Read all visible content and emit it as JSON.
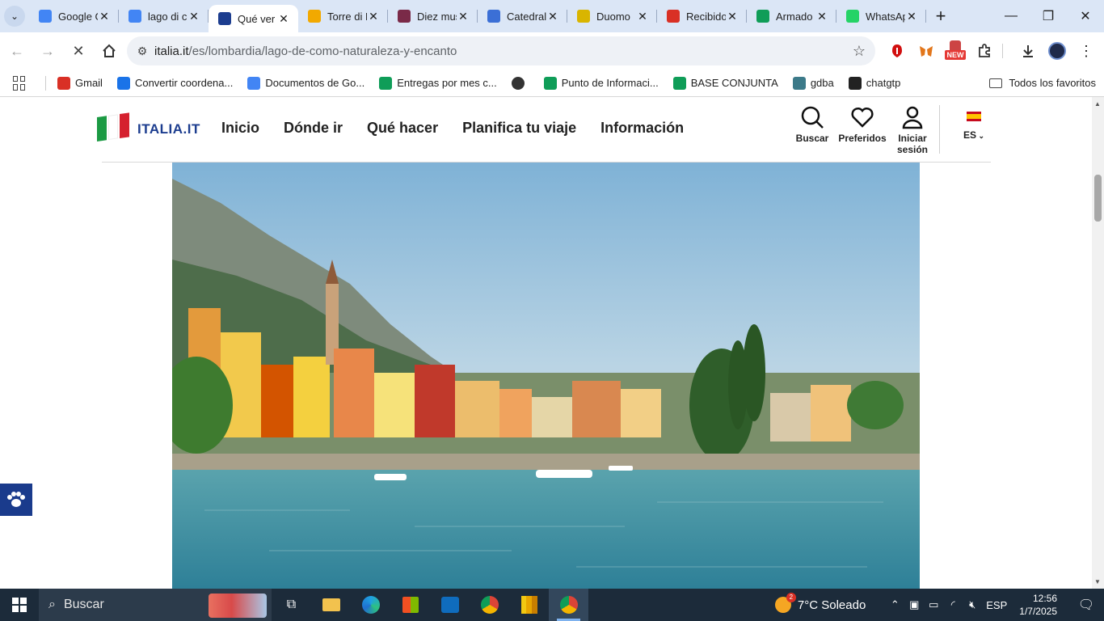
{
  "browser": {
    "tabs": [
      {
        "title": "Google Gemini",
        "icon": "gemini-sparkle-icon",
        "color": "#4285f4",
        "active": false
      },
      {
        "title": "lago di como",
        "icon": "google-g-icon",
        "color": "#4285f4",
        "active": false
      },
      {
        "title": "Qué ver en el lago",
        "icon": "italia-site-icon",
        "color": "#1c3d8f",
        "active": true
      },
      {
        "title": "Torre di Milano",
        "icon": "ef-icon",
        "color": "#f2a900",
        "active": false
      },
      {
        "title": "Diez museos",
        "icon": "document-icon",
        "color": "#7a2a48",
        "active": false
      },
      {
        "title": "Catedral",
        "icon": "chart-icon",
        "color": "#3b6fd6",
        "active": false
      },
      {
        "title": "Duomo",
        "icon": "landscape-icon",
        "color": "#d9b500",
        "active": false
      },
      {
        "title": "Recibidos",
        "icon": "gmail-icon",
        "color": "#d93025",
        "active": false
      },
      {
        "title": "Armado",
        "icon": "sheets-icon",
        "color": "#0f9d58",
        "active": false
      },
      {
        "title": "WhatsApp",
        "icon": "whatsapp-icon",
        "color": "#25d366",
        "active": false
      }
    ],
    "url_host": "italia.it",
    "url_path": "/es/lombardia/lago-de-como-naturaleza-y-encanto",
    "ext_badge": "NEW",
    "bookmarks": [
      {
        "label": "Gmail",
        "icon": "gmail-icon",
        "color": "#d93025"
      },
      {
        "label": "Convertir coordena...",
        "icon": "gps-icon",
        "color": "#1a73e8"
      },
      {
        "label": "Documentos de Go...",
        "icon": "docs-icon",
        "color": "#4285f4"
      },
      {
        "label": "Entregas por mes c...",
        "icon": "sheets-icon",
        "color": "#0f9d58"
      },
      {
        "label": "",
        "icon": "globe-icon",
        "color": "#333333"
      },
      {
        "label": "Punto de Informaci...",
        "icon": "sheets-icon",
        "color": "#0f9d58"
      },
      {
        "label": "BASE CONJUNTA",
        "icon": "sheets-icon",
        "color": "#0f9d58"
      },
      {
        "label": "gdba",
        "icon": "gdba-icon",
        "color": "#3c7a89"
      },
      {
        "label": "chatgtp",
        "icon": "openai-icon",
        "color": "#222222"
      }
    ],
    "all_favorites": "Todos los favoritos"
  },
  "site": {
    "logo_text": "ITALIA.IT",
    "nav": [
      "Inicio",
      "Dónde ir",
      "Qué hacer",
      "Planifica tu viaje",
      "Información"
    ],
    "search_label": "Buscar",
    "favorites_label": "Preferidos",
    "login_label_1": "Iniciar",
    "login_label_2": "sesión",
    "lang": "ES"
  },
  "taskbar": {
    "search_placeholder": "Buscar",
    "weather": "7°C Soleado",
    "weather_badge": "2",
    "lang": "ESP",
    "time": "12:56",
    "date": "1/7/2025"
  }
}
